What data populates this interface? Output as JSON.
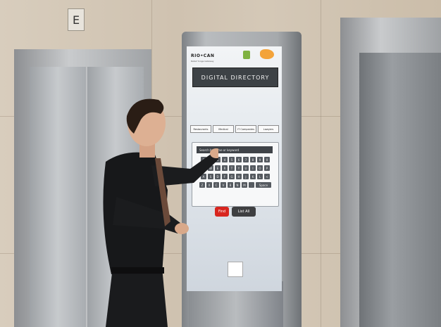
{
  "scene": {
    "floor_sign": "E",
    "colors": {
      "wall": "#d2c6b4",
      "elevator_steel": "#b5b8bb",
      "kiosk_frame": "#a6a9ac",
      "accent_red": "#d8261f",
      "dark_bar": "#3d4246"
    }
  },
  "kiosk": {
    "brand": "RIO•CAN",
    "brand_sub": "Retail Yonge Gateway",
    "title": "DIGITAL DIRECTORY",
    "categories": [
      "Restaurants",
      "Medical",
      "IT Companies",
      "Lawyers"
    ],
    "search_placeholder": "Search by name or keyword",
    "keyboard_rows": [
      [
        "1",
        "2",
        "3",
        "4",
        "5",
        "6",
        "7",
        "8",
        "9",
        "0"
      ],
      [
        "Q",
        "W",
        "E",
        "R",
        "T",
        "Y",
        "U",
        "I",
        "O",
        "P"
      ],
      [
        "A",
        "S",
        "D",
        "F",
        "G",
        "H",
        "J",
        "K",
        "L",
        "<"
      ],
      [
        "Z",
        "X",
        "C",
        "V",
        "B",
        "N",
        "M",
        ".",
        "Space"
      ]
    ],
    "find_label": "Find",
    "list_all_label": "List All"
  }
}
